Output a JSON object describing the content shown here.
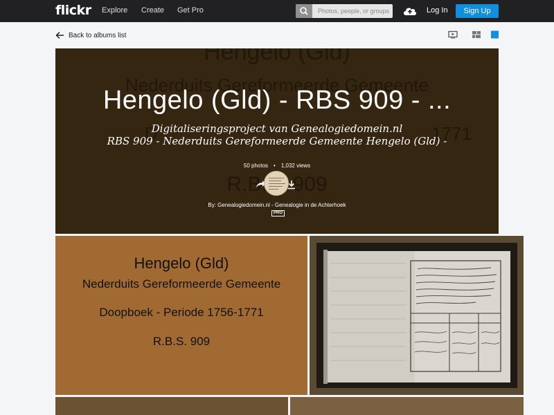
{
  "nav": {
    "logo": "flickr",
    "links": [
      "Explore",
      "Create",
      "Get Pro"
    ],
    "search_placeholder": "Photos, people, or groups",
    "login": "Log In",
    "signup": "Sign Up",
    "colors": {
      "bar": "#212124",
      "accent": "#128fdc"
    }
  },
  "subbar": {
    "back_label": "Back to albums list",
    "view_icons": [
      "slideshow-icon",
      "grid-view-icon",
      "justified-view-icon"
    ]
  },
  "album": {
    "title": "Hengelo (Gld) - RBS 909 - ...",
    "description_line1": "Digitaliseringsproject van Genealogiedomein.nl",
    "description_line2": "RBS 909 - Nederduits Gereformeerde Gemeente Hengelo (Gld) -",
    "photo_count": "50 photos",
    "views": "1,032 views",
    "by": "By: Genealogiedomein.nl - Genealogie in de Achterhoek",
    "pro_badge": "PRO",
    "cover_text": [
      "Hengelo (Gld)",
      "Nederduits Gereformeerde Gemeente",
      "D",
      "1771",
      "R.B.S. 909"
    ]
  },
  "photos": [
    {
      "lines": [
        "Hengelo (Gld)",
        "Nederduits Gereformeerde Gemeente",
        "Doopboek - Periode 1756-1771",
        "R.B.S. 909"
      ]
    }
  ]
}
